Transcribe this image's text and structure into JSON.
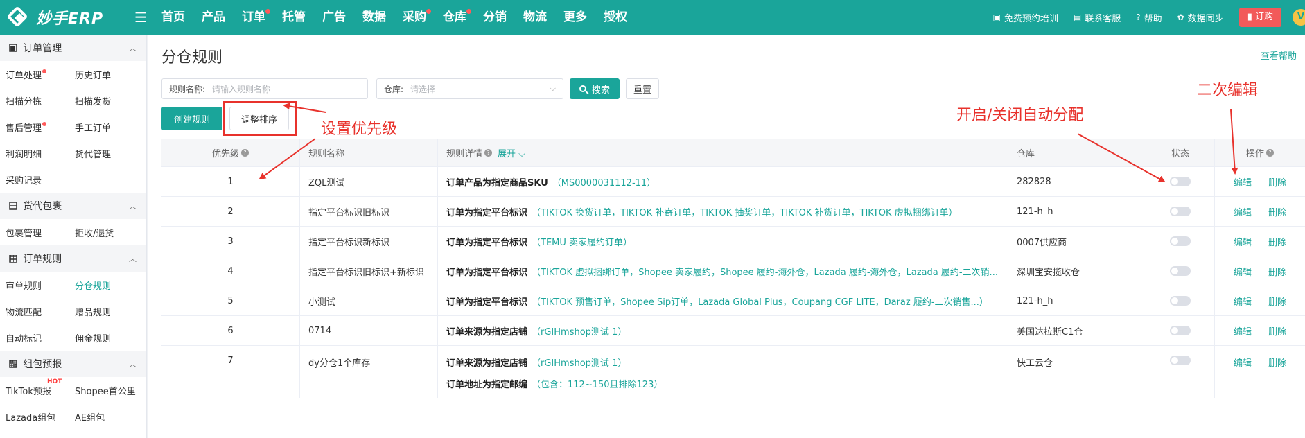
{
  "topbar": {
    "logo_text": "妙手ERP",
    "nav": [
      {
        "label": "首页",
        "dot": false
      },
      {
        "label": "产品",
        "dot": false
      },
      {
        "label": "订单",
        "dot": true
      },
      {
        "label": "托管",
        "dot": false
      },
      {
        "label": "广告",
        "dot": false
      },
      {
        "label": "数据",
        "dot": false
      },
      {
        "label": "采购",
        "dot": true
      },
      {
        "label": "仓库",
        "dot": true
      },
      {
        "label": "分销",
        "dot": false
      },
      {
        "label": "物流",
        "dot": false
      },
      {
        "label": "更多",
        "dot": false
      },
      {
        "label": "授权",
        "dot": false
      }
    ],
    "training": "免费预约培训",
    "service": "联系客服",
    "help": "帮助",
    "sync": "数据同步",
    "order_btn": "订购"
  },
  "sidebar": {
    "groups": [
      {
        "title": "订单管理",
        "icon": "clipboard-icon",
        "rows": [
          [
            {
              "label": "订单处理",
              "dot": true
            },
            {
              "label": "历史订单"
            }
          ],
          [
            {
              "label": "扫描分拣"
            },
            {
              "label": "扫描发货"
            }
          ],
          [
            {
              "label": "售后管理",
              "dot": true
            },
            {
              "label": "手工订单"
            }
          ],
          [
            {
              "label": "利润明细"
            },
            {
              "label": "货代管理"
            }
          ],
          [
            {
              "label": "采购记录"
            }
          ]
        ]
      },
      {
        "title": "货代包裹",
        "icon": "package-icon",
        "rows": [
          [
            {
              "label": "包裹管理"
            },
            {
              "label": "拒收/退货"
            }
          ]
        ]
      },
      {
        "title": "订单规则",
        "icon": "rules-icon",
        "rows": [
          [
            {
              "label": "审单规则"
            },
            {
              "label": "分仓规则",
              "active": true
            }
          ],
          [
            {
              "label": "物流匹配"
            },
            {
              "label": "赠品规则"
            }
          ],
          [
            {
              "label": "自动标记"
            },
            {
              "label": "佣金规则"
            }
          ]
        ]
      },
      {
        "title": "组包预报",
        "icon": "bundle-icon",
        "rows": [
          [
            {
              "label": "TikTok预报",
              "hot": "HOT"
            },
            {
              "label": "Shopee首公里"
            }
          ],
          [
            {
              "label": "Lazada组包"
            },
            {
              "label": "AE组包"
            }
          ]
        ]
      }
    ]
  },
  "main": {
    "title": "分仓规则",
    "help_link": "查看帮助",
    "filters": {
      "name_label": "规则名称:",
      "name_placeholder": "请输入规则名称",
      "warehouse_label": "仓库:",
      "warehouse_placeholder": "请选择",
      "search": "搜索",
      "reset": "重置"
    },
    "create_btn": "创建规则",
    "sort_btn": "调整排序",
    "table": {
      "headers": {
        "priority": "优先级",
        "name": "规则名称",
        "detail": "规则详情",
        "expand": "展开",
        "warehouse": "仓库",
        "status": "状态",
        "ops": "操作"
      },
      "edit": "编辑",
      "delete": "删除",
      "rows": [
        {
          "priority": "1",
          "name": "ZQL测试",
          "details": [
            {
              "label": "订单产品为指定商品SKU",
              "value": "（MS0000031112-11）"
            }
          ],
          "warehouse": "282828"
        },
        {
          "priority": "2",
          "name": "指定平台标识旧标识",
          "details": [
            {
              "label": "订单为指定平台标识",
              "value": "（TIKTOK 换货订单，TIKTOK 补寄订单，TIKTOK 抽奖订单，TIKTOK 补货订单，TIKTOK 虚拟捆绑订单）"
            }
          ],
          "warehouse": "121-h_h"
        },
        {
          "priority": "3",
          "name": "指定平台标识新标识",
          "details": [
            {
              "label": "订单为指定平台标识",
              "value": "（TEMU 卖家履约订单）"
            }
          ],
          "warehouse": "0007供应商"
        },
        {
          "priority": "4",
          "name": "指定平台标识旧标识+新标识",
          "details": [
            {
              "label": "订单为指定平台标识",
              "value": "（TIKTOK 虚拟捆绑订单，Shopee 卖家履约，Shopee 履约-海外仓，Lazada 履约-海外仓，Lazada 履约-二次销..."
            }
          ],
          "warehouse": "深圳宝安揽收仓"
        },
        {
          "priority": "5",
          "name": "小测试",
          "details": [
            {
              "label": "订单为指定平台标识",
              "value": "（TIKTOK 预售订单，Shopee Sip订单，Lazada Global Plus，Coupang CGF LITE，Daraz 履约-二次销售...）"
            }
          ],
          "warehouse": "121-h_h"
        },
        {
          "priority": "6",
          "name": "0714",
          "details": [
            {
              "label": "订单来源为指定店铺",
              "value": "（rGIHmshop测试 1）"
            }
          ],
          "warehouse": "美国达拉斯C1仓"
        },
        {
          "priority": "7",
          "name": "dy分仓1个库存",
          "details": [
            {
              "label": "订单来源为指定店铺",
              "value": "（rGIHmshop测试 1）"
            },
            {
              "label": "订单地址为指定邮编",
              "value": "（包含：112~150且排除123）"
            }
          ],
          "warehouse": "快工云仓"
        }
      ]
    }
  },
  "annotations": {
    "set_priority": "设置优先级",
    "toggle_auto": "开启/关闭自动分配",
    "edit_again": "二次编辑"
  },
  "colors": {
    "primary": "#1aa59a",
    "accent_red": "#e8322c",
    "order_btn": "#f25a5a"
  }
}
